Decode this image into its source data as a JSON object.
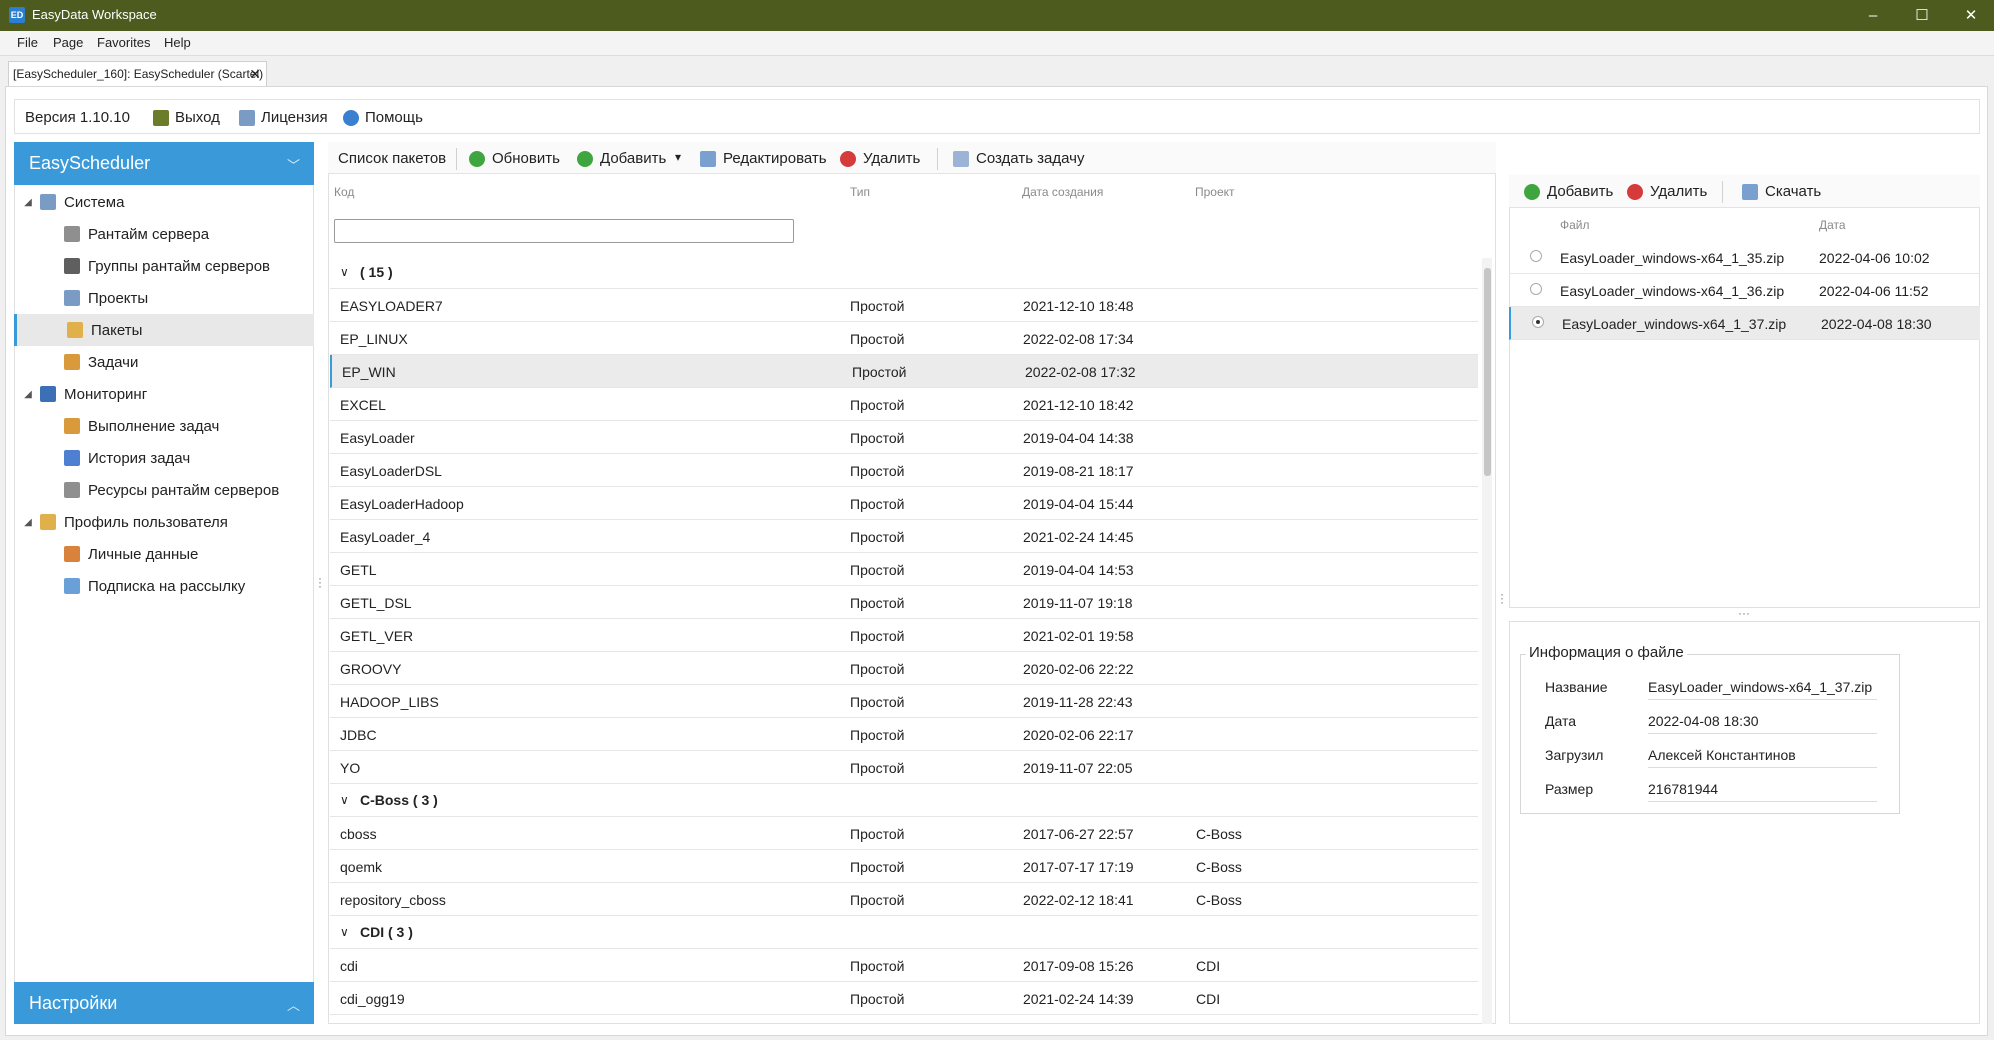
{
  "window": {
    "app_icon_text": "ED",
    "title": "EasyData Workspace",
    "minimize": "–",
    "maximize": "☐",
    "close": "✕"
  },
  "menu": [
    "File",
    "Page",
    "Favorites",
    "Help"
  ],
  "doc_tab": {
    "label": "[EasyScheduler_160]: EasyScheduler (Scartel)",
    "close": "✕"
  },
  "top_toolbar": {
    "version": "Версия 1.10.10",
    "exit": "Выход",
    "license": "Лицензия",
    "help": "Помощь"
  },
  "sidebar": {
    "title": "EasyScheduler",
    "settings": "Настройки",
    "tree": [
      {
        "label": "Система",
        "level": 0,
        "expander": "◢",
        "icon_color": "#7a9bc4",
        "icon": "window-icon"
      },
      {
        "label": "Рантайм сервера",
        "level": 1,
        "icon_color": "#8f8f8f",
        "icon": "server-icon"
      },
      {
        "label": "Группы рантайм серверов",
        "level": 1,
        "icon_color": "#5f5f5f",
        "icon": "server-group-icon"
      },
      {
        "label": "Проекты",
        "level": 1,
        "icon_color": "#7a9bc4",
        "icon": "project-icon"
      },
      {
        "label": "Пакеты",
        "level": 1,
        "selected": true,
        "icon_color": "#e0b04a",
        "icon": "package-icon"
      },
      {
        "label": "Задачи",
        "level": 1,
        "icon_color": "#d99a3c",
        "icon": "task-icon"
      },
      {
        "label": "Мониторинг",
        "level": 0,
        "expander": "◢",
        "icon_color": "#3b6fb6",
        "icon": "monitor-icon"
      },
      {
        "label": "Выполнение задач",
        "level": 1,
        "icon_color": "#d99a3c",
        "icon": "task-run-icon"
      },
      {
        "label": "История задач",
        "level": 1,
        "icon_color": "#4e7fd0",
        "icon": "chart-icon"
      },
      {
        "label": "Ресурсы рантайм серверов",
        "level": 1,
        "icon_color": "#8f8f8f",
        "icon": "resource-icon"
      },
      {
        "label": "Профиль пользователя",
        "level": 0,
        "expander": "◢",
        "icon_color": "#e0b04a",
        "icon": "profile-icon"
      },
      {
        "label": "Личные данные",
        "level": 1,
        "icon_color": "#d9823c",
        "icon": "user-icon"
      },
      {
        "label": "Подписка на рассылку",
        "level": 1,
        "icon_color": "#6aa0d8",
        "icon": "subscription-icon"
      }
    ]
  },
  "center": {
    "toolbar": {
      "list": "Список пакетов",
      "refresh": "Обновить",
      "add": "Добавить",
      "dropdown": "▾",
      "edit": "Редактировать",
      "delete": "Удалить",
      "create_task": "Создать задачу"
    },
    "columns": [
      "Код",
      "Тип",
      "Дата создания",
      "Проект"
    ],
    "groups": [
      {
        "label": "( 15 )",
        "rows": [
          {
            "code": "EASYLOADER7",
            "type": "Простой",
            "date": "2021-12-10 18:48",
            "project": ""
          },
          {
            "code": "EP_LINUX",
            "type": "Простой",
            "date": "2022-02-08 17:34",
            "project": ""
          },
          {
            "code": "EP_WIN",
            "type": "Простой",
            "date": "2022-02-08 17:32",
            "project": "",
            "selected": true
          },
          {
            "code": "EXCEL",
            "type": "Простой",
            "date": "2021-12-10 18:42",
            "project": ""
          },
          {
            "code": "EasyLoader",
            "type": "Простой",
            "date": "2019-04-04 14:38",
            "project": ""
          },
          {
            "code": "EasyLoaderDSL",
            "type": "Простой",
            "date": "2019-08-21 18:17",
            "project": ""
          },
          {
            "code": "EasyLoaderHadoop",
            "type": "Простой",
            "date": "2019-04-04 15:44",
            "project": ""
          },
          {
            "code": "EasyLoader_4",
            "type": "Простой",
            "date": "2021-02-24 14:45",
            "project": ""
          },
          {
            "code": "GETL",
            "type": "Простой",
            "date": "2019-04-04 14:53",
            "project": ""
          },
          {
            "code": "GETL_DSL",
            "type": "Простой",
            "date": "2019-11-07 19:18",
            "project": ""
          },
          {
            "code": "GETL_VER",
            "type": "Простой",
            "date": "2021-02-01 19:58",
            "project": ""
          },
          {
            "code": "GROOVY",
            "type": "Простой",
            "date": "2020-02-06 22:22",
            "project": ""
          },
          {
            "code": "HADOOP_LIBS",
            "type": "Простой",
            "date": "2019-11-28 22:43",
            "project": ""
          },
          {
            "code": "JDBC",
            "type": "Простой",
            "date": "2020-02-06 22:17",
            "project": ""
          },
          {
            "code": "YO",
            "type": "Простой",
            "date": "2019-11-07 22:05",
            "project": ""
          }
        ]
      },
      {
        "label": "C-Boss ( 3 )",
        "rows": [
          {
            "code": "cboss",
            "type": "Простой",
            "date": "2017-06-27 22:57",
            "project": "C-Boss"
          },
          {
            "code": "qoemk",
            "type": "Простой",
            "date": "2017-07-17 17:19",
            "project": "C-Boss"
          },
          {
            "code": "repository_cboss",
            "type": "Простой",
            "date": "2022-02-12 18:41",
            "project": "C-Boss"
          }
        ]
      },
      {
        "label": "CDI ( 3 )",
        "rows": [
          {
            "code": "cdi",
            "type": "Простой",
            "date": "2017-09-08 15:26",
            "project": "CDI"
          },
          {
            "code": "cdi_ogg19",
            "type": "Простой",
            "date": "2021-02-24 14:39",
            "project": "CDI"
          }
        ]
      }
    ]
  },
  "files": {
    "toolbar": {
      "add": "Добавить",
      "delete": "Удалить",
      "download": "Скачать"
    },
    "columns": [
      "Файл",
      "Дата"
    ],
    "rows": [
      {
        "file": "EasyLoader_windows-x64_1_35.zip",
        "date": "2022-04-06 10:02"
      },
      {
        "file": "EasyLoader_windows-x64_1_36.zip",
        "date": "2022-04-06 11:52"
      },
      {
        "file": "EasyLoader_windows-x64_1_37.zip",
        "date": "2022-04-08 18:30",
        "selected": true
      }
    ]
  },
  "info": {
    "title": "Информация о файле",
    "fields": [
      {
        "label": "Название",
        "value": "EasyLoader_windows-x64_1_37.zip"
      },
      {
        "label": "Дата",
        "value": "2022-04-08 18:30"
      },
      {
        "label": "Загрузил",
        "value": "Алексей Константинов"
      },
      {
        "label": "Размер",
        "value": "216781944"
      }
    ]
  },
  "colors": {
    "titlebar": "#4d5b1f",
    "accent": "#3a9ad9",
    "add": "#3fa53f",
    "delete": "#d63b3b"
  }
}
